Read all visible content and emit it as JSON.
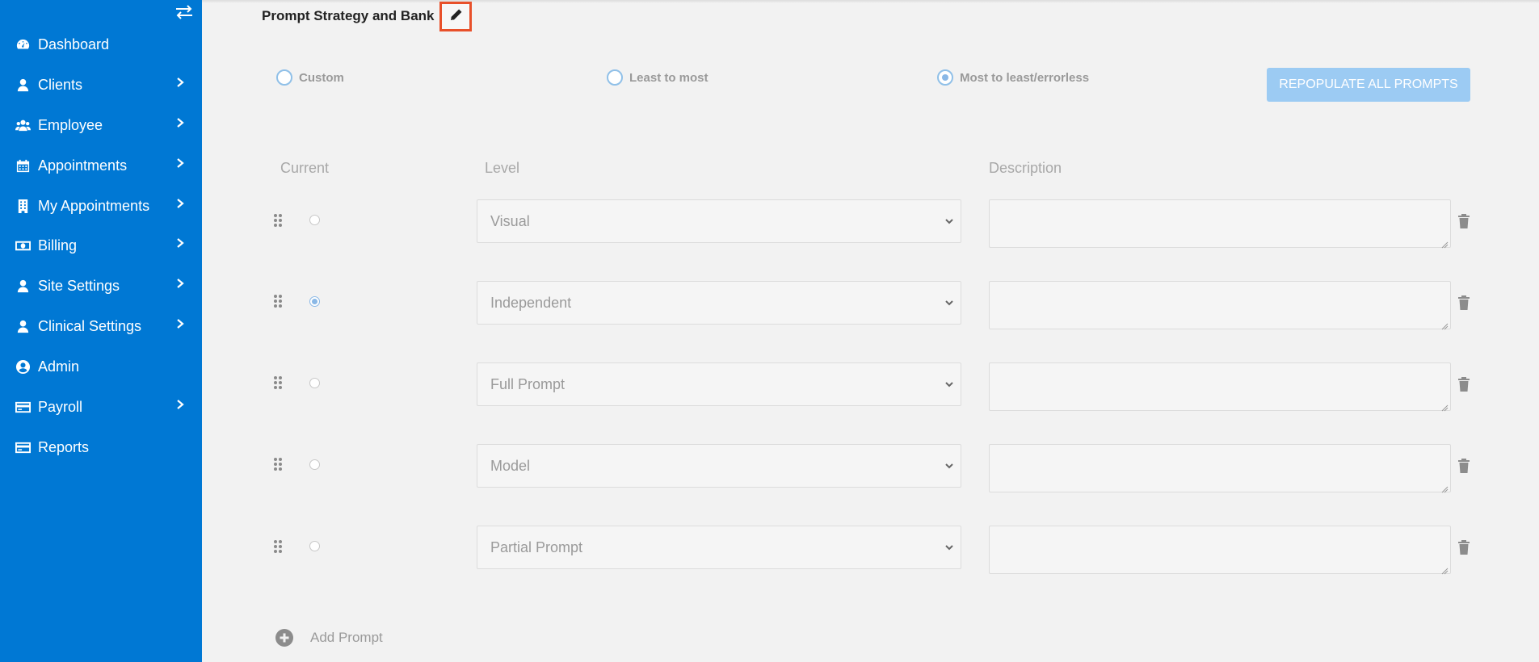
{
  "sidebar": {
    "items": [
      {
        "label": "Dashboard",
        "icon": "dashboard-icon",
        "has_submenu": false
      },
      {
        "label": "Clients",
        "icon": "user-icon",
        "has_submenu": true
      },
      {
        "label": "Employee",
        "icon": "users-icon",
        "has_submenu": true
      },
      {
        "label": "Appointments",
        "icon": "calendar-icon",
        "has_submenu": true
      },
      {
        "label": "My Appointments",
        "icon": "building-icon",
        "has_submenu": true
      },
      {
        "label": "Billing",
        "icon": "money-icon",
        "has_submenu": true
      },
      {
        "label": "Site Settings",
        "icon": "user-icon",
        "has_submenu": true
      },
      {
        "label": "Clinical Settings",
        "icon": "user-icon",
        "has_submenu": true
      },
      {
        "label": "Admin",
        "icon": "user-circle-icon",
        "has_submenu": false
      },
      {
        "label": "Payroll",
        "icon": "credit-card-icon",
        "has_submenu": true
      },
      {
        "label": "Reports",
        "icon": "credit-card-icon",
        "has_submenu": false
      }
    ]
  },
  "page": {
    "title": "Prompt Strategy and Bank",
    "edit_icon": "pencil-icon"
  },
  "strategies": [
    {
      "label": "Custom",
      "selected": false
    },
    {
      "label": "Least to most",
      "selected": false
    },
    {
      "label": "Most to least/errorless",
      "selected": true
    }
  ],
  "repopulate_label": "REPOPULATE ALL PROMPTS",
  "columns": {
    "current": "Current",
    "level": "Level",
    "description": "Description"
  },
  "prompts": [
    {
      "level": "Visual",
      "current": false,
      "description": ""
    },
    {
      "level": "Independent",
      "current": true,
      "description": ""
    },
    {
      "level": "Full Prompt",
      "current": false,
      "description": ""
    },
    {
      "level": "Model",
      "current": false,
      "description": ""
    },
    {
      "level": "Partial Prompt",
      "current": false,
      "description": ""
    }
  ],
  "add_prompt_label": "Add Prompt",
  "colors": {
    "sidebar": "#0078d4",
    "accent": "#8ab8e6",
    "button": "#9ccbf3",
    "highlight": "#e8502a"
  }
}
